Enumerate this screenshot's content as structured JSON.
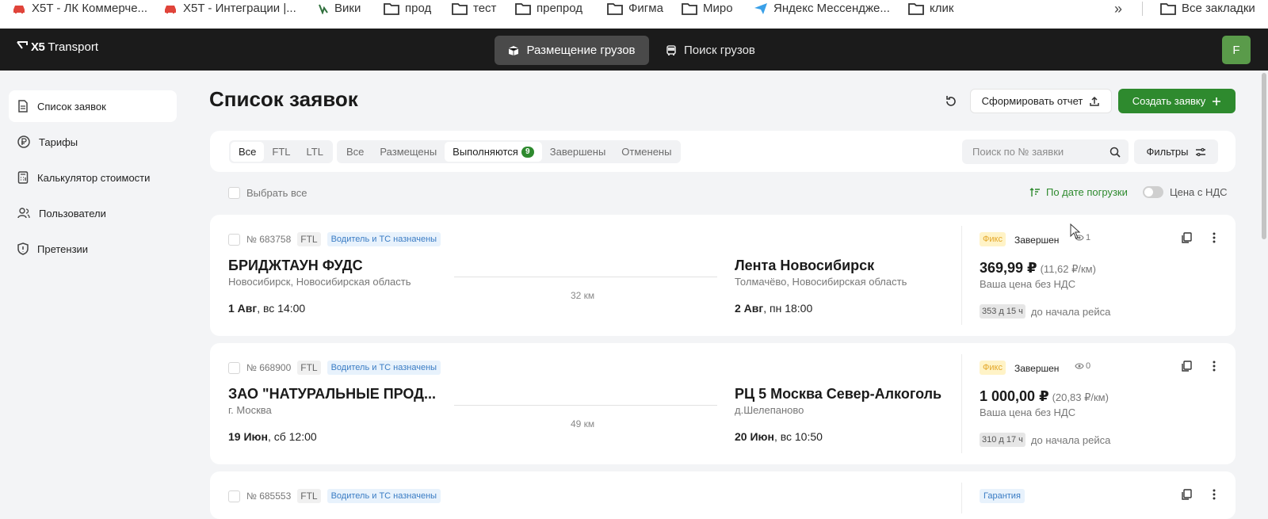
{
  "bookmarks": {
    "items": [
      {
        "label": "X5T - ЛК Коммерче..."
      },
      {
        "label": "X5T - Интеграции |..."
      },
      {
        "label": "Вики"
      },
      {
        "label": "прод"
      },
      {
        "label": "тест"
      },
      {
        "label": "препрод"
      },
      {
        "label": "Фигма"
      },
      {
        "label": "Миро"
      },
      {
        "label": "Яндекс Мессендже..."
      },
      {
        "label": "клик"
      }
    ],
    "more": "»",
    "all": "Все закладки"
  },
  "header": {
    "logo_mark": "X5",
    "logo_word": "Transport",
    "tab_place": "Размещение грузов",
    "tab_search": "Поиск грузов",
    "avatar": "F"
  },
  "sidebar": {
    "items": [
      {
        "label": "Список заявок",
        "icon": "document-icon"
      },
      {
        "label": "Тарифы",
        "icon": "ruble-icon"
      },
      {
        "label": "Калькулятор стоимости",
        "icon": "calculator-icon"
      },
      {
        "label": "Пользователи",
        "icon": "users-icon"
      },
      {
        "label": "Претензии",
        "icon": "shield-icon"
      }
    ]
  },
  "main": {
    "title": "Список заявок",
    "report_btn": "Сформировать отчет",
    "create_btn": "Создать заявку",
    "type_filter": [
      "Все",
      "FTL",
      "LTL"
    ],
    "status_filter": [
      {
        "label": "Все"
      },
      {
        "label": "Размещены"
      },
      {
        "label": "Выполняются",
        "count": "9"
      },
      {
        "label": "Завершены"
      },
      {
        "label": "Отменены"
      }
    ],
    "search_placeholder": "Поиск по № заявки",
    "filters_btn": "Фильтры",
    "select_all": "Выбрать все",
    "sort_label": "По дате погрузки",
    "vat_label": "Цена с НДС"
  },
  "orders": [
    {
      "number": "№ 683758",
      "type": "FTL",
      "status_tag": "Водитель и ТС назначены",
      "from_name": "БРИДЖТАУН ФУДС",
      "from_addr": "Новосибирск, Новосибирская область",
      "from_date_bold": "1 Авг",
      "from_date_rest": ", вс 14:00",
      "distance": "32 км",
      "to_name": "Лента Новосибирск",
      "to_addr": "Толмачёво, Новосибирская область",
      "to_date_bold": "2 Авг",
      "to_date_rest": ", пн 18:00",
      "badge": "Фикс",
      "state": "Завершен",
      "views": "1",
      "price": "369,99 ₽",
      "price_per_km": "(11,62 ₽/км)",
      "price_note": "Ваша цена без НДС",
      "timer": "353 д 15 ч",
      "timer_note": "до начала рейса"
    },
    {
      "number": "№ 668900",
      "type": "FTL",
      "status_tag": "Водитель и ТС назначены",
      "from_name": "ЗАО \"НАТУРАЛЬНЫЕ ПРОД...",
      "from_addr": "г. Москва",
      "from_date_bold": "19 Июн",
      "from_date_rest": ", сб 12:00",
      "distance": "49 км",
      "to_name": "РЦ 5 Москва Север-Алкоголь",
      "to_addr": "д.Шелепаново",
      "to_date_bold": "20 Июн",
      "to_date_rest": ", вс 10:50",
      "badge": "Фикс",
      "state": "Завершен",
      "views": "0",
      "price": "1 000,00 ₽",
      "price_per_km": "(20,83 ₽/км)",
      "price_note": "Ваша цена без НДС",
      "timer": "310 д 17 ч",
      "timer_note": "до начала рейса"
    },
    {
      "number": "№ 685553",
      "type": "FTL",
      "status_tag": "Водитель и ТС назначены",
      "badge": "Гарантия"
    }
  ],
  "colors": {
    "accent_green": "#2e8a2e",
    "header_bg": "#1b1b1b",
    "status_blue": "#3a7cc4",
    "fix_yellow": "#e3a72a"
  }
}
